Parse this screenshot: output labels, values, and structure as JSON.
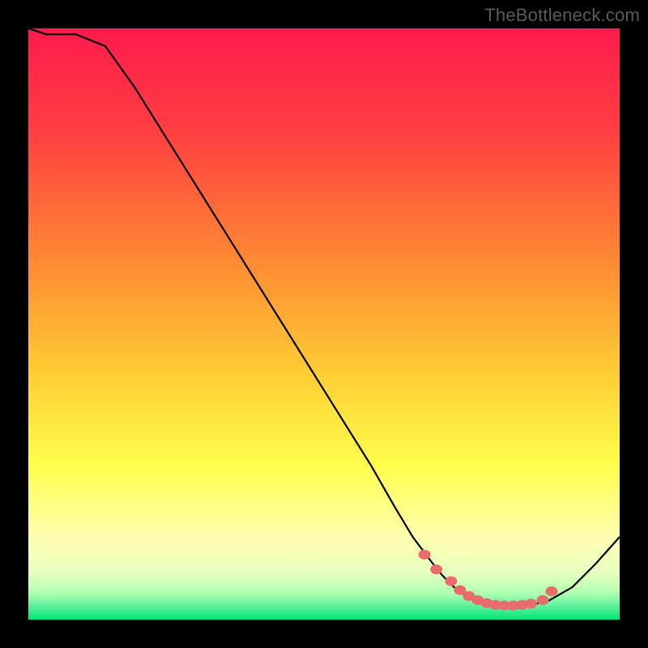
{
  "watermark": "TheBottleneck.com",
  "colors": {
    "gradient_top": "#ff1a4d",
    "gradient_mid1": "#ff7a33",
    "gradient_mid2": "#ffd633",
    "gradient_mid3": "#ffff66",
    "gradient_mid4": "#f2ffb3",
    "gradient_bottom": "#00e673",
    "curve": "#000000",
    "dot": "#e96b6b",
    "frame": "#000000"
  },
  "chart_data": {
    "type": "line",
    "title": "",
    "xlabel": "",
    "ylabel": "",
    "xlim": [
      0,
      100
    ],
    "ylim": [
      0,
      100
    ],
    "series": [
      {
        "name": "bottleneck-curve",
        "x": [
          0,
          3,
          8,
          13,
          18,
          23,
          28,
          33,
          38,
          43,
          48,
          53,
          58,
          62,
          65,
          68,
          70,
          72,
          74,
          76,
          78,
          80,
          82,
          85,
          88,
          92,
          96,
          100
        ],
        "y": [
          100,
          99,
          99,
          97,
          90,
          82,
          74,
          66,
          58,
          50,
          42,
          34,
          26,
          19,
          14,
          10,
          7.5,
          5.5,
          4,
          3,
          2.5,
          2.3,
          2.3,
          2.5,
          3.2,
          5.5,
          9.5,
          14
        ]
      }
    ],
    "markers": {
      "name": "highlight-dots",
      "x": [
        67,
        69,
        71.5,
        73,
        74.5,
        76,
        77.5,
        79,
        80.5,
        82,
        83.5,
        85,
        87,
        88.5
      ],
      "y": [
        11,
        8.5,
        6.5,
        5,
        4,
        3.3,
        2.8,
        2.5,
        2.4,
        2.4,
        2.5,
        2.7,
        3.3,
        4.8
      ]
    }
  }
}
